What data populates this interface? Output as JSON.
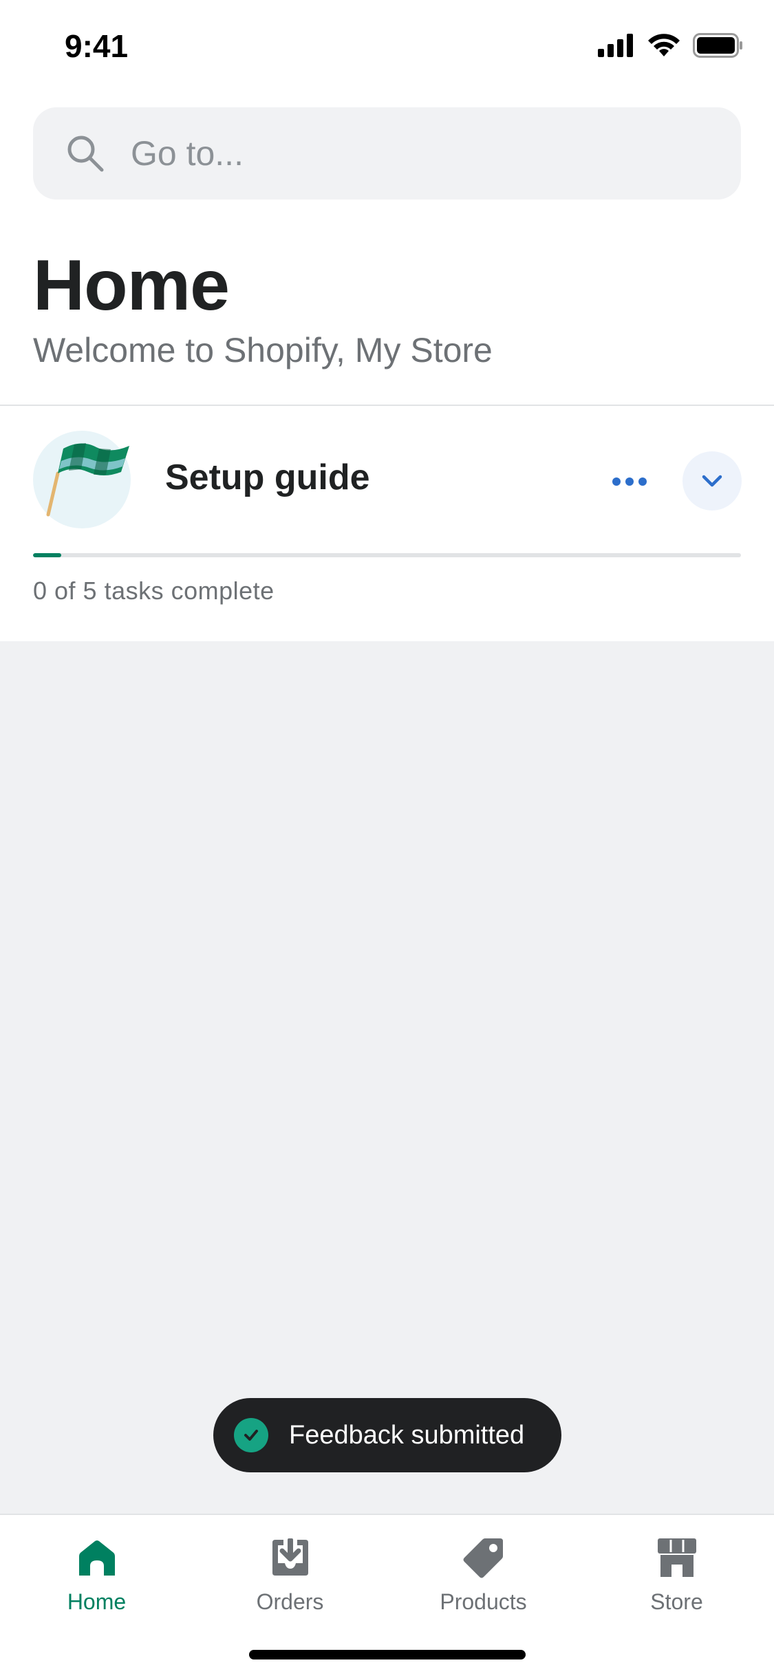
{
  "status_bar": {
    "time": "9:41"
  },
  "search": {
    "placeholder": "Go to..."
  },
  "header": {
    "title": "Home",
    "subtitle": "Welcome to Shopify, My Store"
  },
  "setup_guide": {
    "title": "Setup guide",
    "progress_text": "0 of 5 tasks complete",
    "progress_fraction": 0.04
  },
  "toast": {
    "message": "Feedback submitted"
  },
  "tabs": [
    {
      "label": "Home",
      "icon": "home-icon",
      "active": true
    },
    {
      "label": "Orders",
      "icon": "orders-icon",
      "active": false
    },
    {
      "label": "Products",
      "icon": "tag-icon",
      "active": false
    },
    {
      "label": "Store",
      "icon": "store-icon",
      "active": false
    }
  ],
  "colors": {
    "accent": "#008060",
    "link": "#2c6ecb",
    "toast_bg": "#202123",
    "background": "#f0f1f3"
  }
}
